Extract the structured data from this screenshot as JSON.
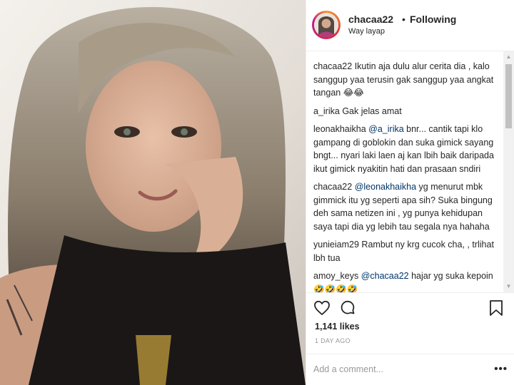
{
  "post": {
    "username": "chacaa22",
    "separator": "•",
    "follow_status": "Following",
    "location": "Way layap"
  },
  "comments": [
    {
      "user": "chacaa22",
      "mention": "",
      "text": "Ikutin aja dulu alur cerita dia , kalo sanggup yaa terusin gak sanggup yaa angkat tangan 😂😂"
    },
    {
      "user": "a_irika",
      "mention": "",
      "text": "Gak jelas amat"
    },
    {
      "user": "leonakhaikha",
      "mention": "@a_irika",
      "text": "bnr... cantik tapi klo gampang di goblokin dan suka gimick sayang bngt... nyari laki laen aj kan lbih baik daripada ikut gimick nyakitin hati dan prasaan sndiri"
    },
    {
      "user": "chacaa22",
      "mention": "@leonakhaikha",
      "text": "yg menurut mbk gimmick itu yg seperti apa sih? Suka bingung deh sama netizen ini , yg punya kehidupan saya tapi dia yg lebih tau segala nya hahaha"
    },
    {
      "user": "yunieiam29",
      "mention": "",
      "text": "Rambut ny krg cucok cha, , trlihat lbh tua"
    },
    {
      "user": "amoy_keys",
      "mention": "@chacaa22",
      "text": "hajar yg suka kepoin 🤣🤣🤣🤣"
    }
  ],
  "likes": "1,141 likes",
  "time_ago": "1 DAY AGO",
  "add_comment": {
    "placeholder": "Add a comment..."
  },
  "menu_glyph": "•••",
  "icons": [
    "heart-icon",
    "comment-icon",
    "bookmark-icon",
    "more-options-icon"
  ],
  "colors": {
    "text": "#262626",
    "muted": "#999999",
    "mention": "#003569",
    "border": "#efefef"
  }
}
